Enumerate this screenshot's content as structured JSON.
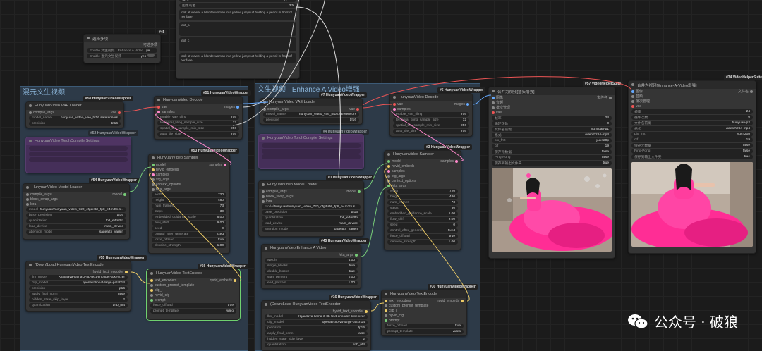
{
  "colors": {
    "group_bg": "#2d3a48",
    "node_bg": "#353535",
    "accent_green": "#6fd16f"
  },
  "top_box": {
    "rows": [
      {
        "label": "操作",
        "value": "append"
      },
      {
        "label": "图像或者",
        "value": "yes"
      }
    ],
    "text1": "look at viewer a blonde women in a yellow jumpsuit holding a pencil in front of her face.",
    "text2": "text_a",
    "text3": "text_c",
    "text4": "look at viewer a blonde woman in a yellow jumpsuit holding a pencil in front of her face."
  },
  "ctrl": {
    "title": "选择多项",
    "tag": "#45",
    "right_label": "可选多项",
    "items": [
      {
        "label": "Enable 文生视频 · Enhance A Video...",
        "value": "yes"
      },
      {
        "label": "Enable 混元文生视频",
        "value": "yes"
      }
    ]
  },
  "group1": {
    "title": "混元文生视频",
    "nodes": {
      "vae": {
        "tag": "#50 HunyuanVideoWrapper",
        "title": "HunyuanVideo VAE Loader",
        "in": "compile_args",
        "out": "vae",
        "rows": [
          {
            "l": "model_name",
            "v": "hunyuan_video_vae_bf16.safetensors"
          },
          {
            "l": "precision",
            "v": "bf16"
          }
        ]
      },
      "decode": {
        "tag": "#51 HunyuanVideoWrapper",
        "title": "HunyuanVideo Decode",
        "ins": [
          "vae",
          "samples"
        ],
        "out": "images",
        "rows": [
          {
            "l": "enable_vae_tiling",
            "v": "true"
          },
          {
            "l": "temporal_tiling_sample_size",
            "v": "32"
          },
          {
            "l": "spatial_tile_sample_min_size",
            "v": "256"
          },
          {
            "l": "auto_tile_size",
            "v": "true"
          }
        ]
      },
      "purple": {
        "tag": "#52 HunyuanVideoWrapper",
        "title": "HunyuanVideo TorchCompile Settings"
      },
      "sampler": {
        "tag": "#53 HunyuanVideoWrapper",
        "title": "HunyuanVideo Sampler",
        "ins": [
          "model",
          "hyvid_embeds",
          "samples",
          "stg_args",
          "context_options",
          "feta_args"
        ],
        "out": "samples",
        "rows": [
          {
            "l": "width",
            "v": "720"
          },
          {
            "l": "height",
            "v": "480"
          },
          {
            "l": "num_frames",
            "v": "73"
          },
          {
            "l": "steps",
            "v": "30"
          },
          {
            "l": "embedded_guidance_scale",
            "v": "6.00"
          },
          {
            "l": "flow_shift",
            "v": "9.00"
          },
          {
            "l": "seed",
            "v": "0"
          },
          {
            "l": "control_after_generate",
            "v": "fixed"
          },
          {
            "l": "force_offload",
            "v": "true"
          },
          {
            "l": "denoise_strength",
            "v": "1.00"
          }
        ]
      },
      "model": {
        "tag": "#54 HunyuanVideoWrapper",
        "title": "HunyuanVideo Model Loader",
        "ins": [
          "compile_args",
          "block_swap_args",
          "lora"
        ],
        "out": "model",
        "rows": [
          {
            "l": "model",
            "v": "hunyuan\\hunyuan_video_720_cfgdistill_fp8_e4m3fn.s..."
          },
          {
            "l": "base_precision",
            "v": "bf16"
          },
          {
            "l": "quantization",
            "v": "fp8_e4m3fn"
          },
          {
            "l": "load_device",
            "v": "main_device"
          },
          {
            "l": "attention_mode",
            "v": "sageattn_varlen"
          }
        ]
      },
      "textenc": {
        "tag": "#55 HunyuanVideoWrapper",
        "title": "(Down)Load HunyuanVideo TextEncoder",
        "out": "hyvid_text_encoder",
        "rows": [
          {
            "l": "llm_model",
            "v": "Kijai/llava-llama-3-8b-text-encoder-tokenizer"
          },
          {
            "l": "clip_model",
            "v": "openai/clip-vit-large-patch14"
          },
          {
            "l": "precision",
            "v": "fp16"
          },
          {
            "l": "apply_final_norm",
            "v": "false"
          },
          {
            "l": "hidden_state_skip_layer",
            "v": "2"
          },
          {
            "l": "quantization",
            "v": "bnb_nf4"
          }
        ]
      },
      "encode": {
        "tag": "#56 HunyuanVideoWrapper",
        "title": "HunyuanVideo TextEncode",
        "ins": [
          "text_encoders",
          "custom_prompt_template",
          "clip_l",
          "hyvid_cfg"
        ],
        "out": "hyvid_embeds",
        "rows": [
          {
            "l": "prompt",
            "v": ""
          },
          {
            "l": "force_offload",
            "v": "true"
          },
          {
            "l": "prompt_template",
            "v": "video"
          }
        ]
      }
    }
  },
  "group2": {
    "title": "文生视频 · Enhance A Video增强",
    "nodes": {
      "vae": {
        "tag": "#7 HunyuanVideoWrapper",
        "title": "HunyuanVideo VAE Loader",
        "in": "compile_args",
        "out": "vae",
        "rows": [
          {
            "l": "model_name",
            "v": "hunyuan_video_vae_bf16.safetensors"
          },
          {
            "l": "precision",
            "v": "bf16"
          }
        ]
      },
      "decode": {
        "tag": "#5 HunyuanVideoWrapper",
        "title": "HunyuanVideo Decode",
        "ins": [
          "vae",
          "samples"
        ],
        "out": "images",
        "rows": [
          {
            "l": "enable_vae_tiling",
            "v": "true"
          },
          {
            "l": "temporal_tiling_sample_size",
            "v": "32"
          },
          {
            "l": "spatial_tile_sample_min_size",
            "v": "256"
          },
          {
            "l": "auto_tile_size",
            "v": "true"
          }
        ]
      },
      "purple": {
        "tag": "#4 HunyuanVideoWrapper",
        "title": "HunyuanVideo TorchCompile Settings"
      },
      "sampler": {
        "tag": "#3 HunyuanVideoWrapper",
        "title": "HunyuanVideo Sampler",
        "ins": [
          "model",
          "hyvid_embeds",
          "samples",
          "stg_args",
          "context_options",
          "feta_args"
        ],
        "out": "samples",
        "rows": [
          {
            "l": "width",
            "v": "720"
          },
          {
            "l": "height",
            "v": "480"
          },
          {
            "l": "num_frames",
            "v": "73"
          },
          {
            "l": "steps",
            "v": "30"
          },
          {
            "l": "embedded_guidance_scale",
            "v": "6.00"
          },
          {
            "l": "flow_shift",
            "v": "9.00"
          },
          {
            "l": "seed",
            "v": "0"
          },
          {
            "l": "control_after_generate",
            "v": "fixed"
          },
          {
            "l": "force_offload",
            "v": "true"
          },
          {
            "l": "denoise_strength",
            "v": "1.00"
          }
        ]
      },
      "model": {
        "tag": "#1 HunyuanVideoWrapper",
        "title": "HunyuanVideo Model Loader",
        "ins": [
          "compile_args",
          "block_swap_args",
          "lora"
        ],
        "out": "model",
        "rows": [
          {
            "l": "model",
            "v": "hunyuan\\hunyuan_video_720_cfgdistill_fp8_e4m3fn.s..."
          },
          {
            "l": "base_precision",
            "v": "bf16"
          },
          {
            "l": "quantization",
            "v": "fp8_e4m3fn"
          },
          {
            "l": "load_device",
            "v": "main_device"
          },
          {
            "l": "attention_mode",
            "v": "sageattn_varlen"
          }
        ]
      },
      "enhance": {
        "tag": "#45 HunyuanVideoWrapper",
        "title": "HunyuanVideo Enhance A Video",
        "out": "feta_args",
        "rows": [
          {
            "l": "weight",
            "v": "4.00"
          },
          {
            "l": "single_blocks",
            "v": "true"
          },
          {
            "l": "double_blocks",
            "v": "true"
          },
          {
            "l": "start_percent",
            "v": "0.00"
          },
          {
            "l": "end_percent",
            "v": "1.00"
          }
        ]
      },
      "textenc": {
        "tag": "#16 HunyuanVideoWrapper",
        "title": "(Down)Load HunyuanVideo TextEncoder",
        "out": "hyvid_text_encoder",
        "rows": [
          {
            "l": "llm_model",
            "v": "Kijai/llava-llama-3-8b-text-encoder-tokenizer"
          },
          {
            "l": "clip_model",
            "v": "openai/clip-vit-large-patch14"
          },
          {
            "l": "precision",
            "v": "fp16"
          },
          {
            "l": "apply_final_norm",
            "v": "false"
          },
          {
            "l": "hidden_state_skip_layer",
            "v": "2"
          },
          {
            "l": "quantization",
            "v": "bnb_nf4"
          }
        ]
      },
      "encode": {
        "tag": "#30 HunyuanVideoWrapper",
        "title": "HunyuanVideo TextEncode",
        "ins": [
          "text_encoders",
          "custom_prompt_template",
          "clip_l",
          "hyvid_cfg"
        ],
        "out": "hyvid_embeds",
        "rows": [
          {
            "l": "prompt",
            "v": ""
          },
          {
            "l": "force_offload",
            "v": "true"
          },
          {
            "l": "prompt_template",
            "v": "video"
          }
        ]
      }
    }
  },
  "combine1": {
    "tag": "#57 VideoHelperSuite",
    "title": "合并为视频[插头增强]",
    "ins": [
      "图像",
      "音频",
      "批次管理",
      "vae"
    ],
    "out": "文件名",
    "rows": [
      {
        "l": "帧率",
        "v": "24"
      },
      {
        "l": "循环次数",
        "v": "0"
      },
      {
        "l": "文件名前缀",
        "v": "hunyuan-p1"
      },
      {
        "l": "格式",
        "v": "video/h264-mp4"
      },
      {
        "l": "pix_fmt",
        "v": "yuv420p"
      },
      {
        "l": "crf",
        "v": "19"
      },
      {
        "l": "保存元数据",
        "v": "false"
      },
      {
        "l": "Ping-Pong",
        "v": "false"
      },
      {
        "l": "保存到输出文件夹",
        "v": "true"
      }
    ]
  },
  "combine2": {
    "tag": "#34 VideoHelperSuite",
    "title": "合并为视频[Enhance-A-Video增强]",
    "ins": [
      "图像",
      "音频",
      "批次管理",
      "vae"
    ],
    "out": "文件名",
    "rows": [
      {
        "l": "帧率",
        "v": "24"
      },
      {
        "l": "循环次数",
        "v": "0"
      },
      {
        "l": "文件名前缀",
        "v": "hunyuan-p2"
      },
      {
        "l": "格式",
        "v": "video/h264-mp4"
      },
      {
        "l": "pix_fmt",
        "v": "yuv420p"
      },
      {
        "l": "crf",
        "v": "19"
      },
      {
        "l": "保存元数据",
        "v": "false"
      },
      {
        "l": "Ping-Pong",
        "v": "false"
      },
      {
        "l": "保存到输出文件夹",
        "v": "true"
      }
    ]
  },
  "watermark": {
    "text": "公众号 · 破狼",
    "icon": "wechat-icon"
  }
}
